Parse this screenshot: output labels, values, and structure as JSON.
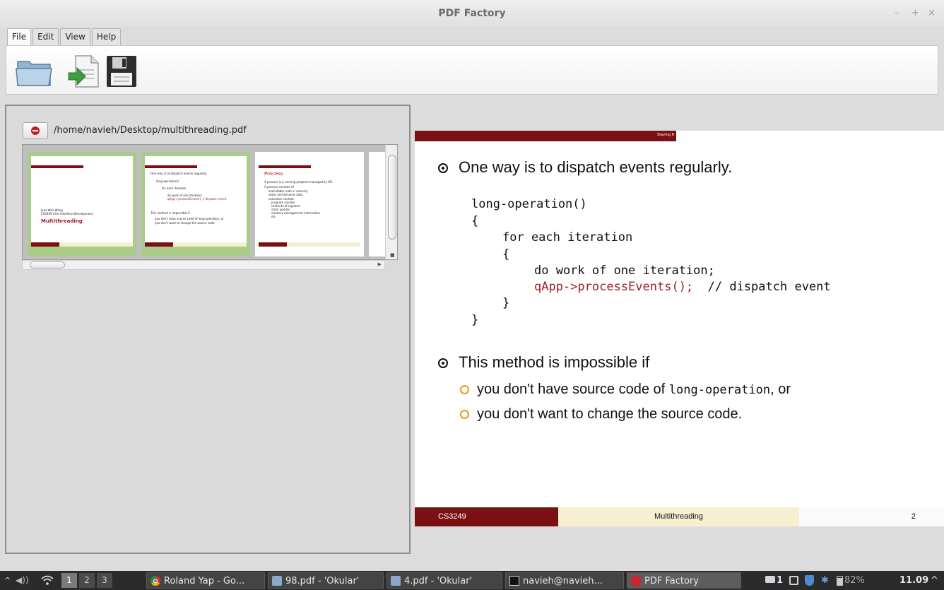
{
  "window": {
    "title": "PDF Factory",
    "controls": {
      "minimize": "–",
      "maximize": "+",
      "close": "×"
    }
  },
  "menu": {
    "tabs": [
      "File",
      "Edit",
      "View",
      "Help"
    ],
    "active": "File"
  },
  "toolbar": {
    "buttons": [
      "folder-open-icon",
      "import-pdf-icon",
      "save-disk-icon"
    ]
  },
  "document": {
    "path": "/home/navieh/Desktop/multithreading.pdf"
  },
  "thumbnails": {
    "page1": {
      "author": "Jens Wen Wang",
      "course": "CS3249 User Interface Development",
      "title": "Multithreading"
    },
    "page2": {
      "lines": [
        "One way is to dispatch events regularly.",
        "long-operation()",
        "for each iteration",
        "do work of one iteration;",
        "qApp->processEvents();  // dispatch event",
        "This method is impossible if",
        "you don't have source code of long-operation, or",
        "you don't want to change the source code."
      ]
    },
    "page3": {
      "title": "Process",
      "lines": [
        "A process is a running program managed by OS.",
        "A process consists of",
        "executable code in memory",
        "static and dynamic data",
        "execution context",
        "program counter",
        "contents of registers",
        "stack pointer",
        "memory management information",
        "etc."
      ]
    },
    "footer": [
      "CS3249",
      "Multithreading"
    ]
  },
  "slide": {
    "header": "Staying R",
    "bullet1": "One way is to dispatch events regularly.",
    "code": {
      "line1": "long-operation()",
      "line2": "{",
      "line3": "for each iteration",
      "line4": "{",
      "line5": "do work of one iteration;",
      "line6_call": "qApp->processEvents();",
      "line6_comment": "  // dispatch event",
      "line7": "}",
      "line8": "}"
    },
    "bullet2": "This method is impossible if",
    "sub1_pre": "you don't have source code of ",
    "sub1_code": "long-operation",
    "sub1_post": ", or",
    "sub2": "you don't want to change the source code.",
    "footer": {
      "course": "CS3249",
      "topic": "Multithreading",
      "page": "2"
    },
    "colors": {
      "brand_red": "#7a1014",
      "footer_cream": "#f6efd0",
      "bullet_orange": "#e89a14"
    }
  },
  "taskbar": {
    "workspaces": [
      "1",
      "2",
      "3"
    ],
    "active_workspace": "1",
    "tasks": [
      {
        "label": "Roland Yap - Go...",
        "icon": "chrome-icon"
      },
      {
        "label": "98.pdf - 'Okular'",
        "icon": "okular-icon"
      },
      {
        "label": "4.pdf - 'Okular'",
        "icon": "okular-icon"
      },
      {
        "label": "navieh@navieh...",
        "icon": "terminal-icon"
      },
      {
        "label": "PDF Factory",
        "icon": "pdf-factory-icon"
      }
    ],
    "tray": {
      "notifications": "1",
      "battery": "82%",
      "clock": "11.09"
    }
  }
}
